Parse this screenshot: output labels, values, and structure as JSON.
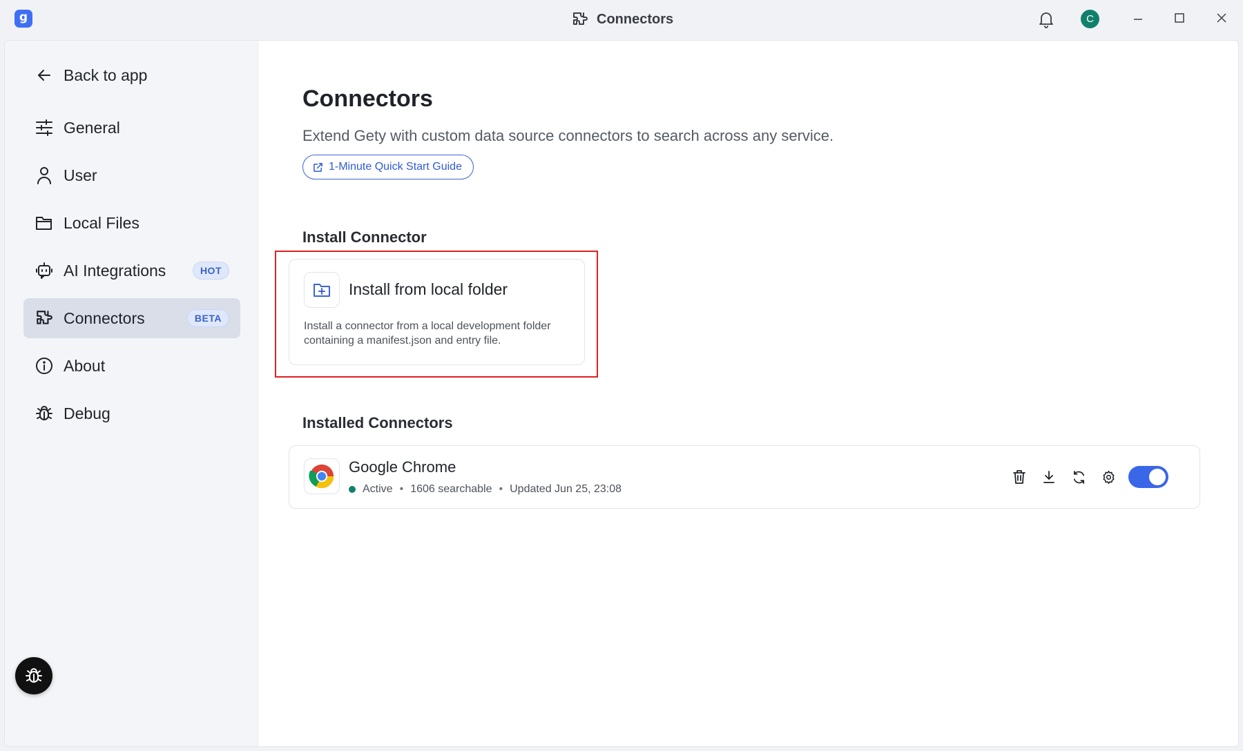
{
  "app": {
    "logo_letter": "g",
    "window_title": "Connectors",
    "avatar_initial": "C"
  },
  "sidebar": {
    "back_label": "Back to app",
    "items": [
      {
        "label": "General",
        "icon": "sliders-icon"
      },
      {
        "label": "User",
        "icon": "user-icon"
      },
      {
        "label": "Local Files",
        "icon": "folder-icon"
      },
      {
        "label": "AI Integrations",
        "icon": "bot-icon",
        "badge": "HOT"
      },
      {
        "label": "Connectors",
        "icon": "puzzle-icon",
        "badge": "BETA",
        "active": true
      },
      {
        "label": "About",
        "icon": "info-icon"
      },
      {
        "label": "Debug",
        "icon": "bug-icon"
      }
    ]
  },
  "main": {
    "title": "Connectors",
    "subtitle": "Extend Gety with custom data source connectors to search across any service.",
    "guide_button": "1-Minute Quick Start Guide",
    "install_section": {
      "heading": "Install Connector",
      "card_title": "Install from local folder",
      "card_description": "Install a connector from a local development folder containing a manifest.json and entry file."
    },
    "installed_section": {
      "heading": "Installed Connectors",
      "connectors": [
        {
          "name": "Google Chrome",
          "status": "Active",
          "searchable": "1606 searchable",
          "updated": "Updated Jun 25, 23:08",
          "enabled": true
        }
      ]
    }
  },
  "colors": {
    "accent": "#3a66e8",
    "active_status": "#11806a",
    "highlight_border": "#e02020",
    "active_nav_bg": "#d9dee9"
  }
}
